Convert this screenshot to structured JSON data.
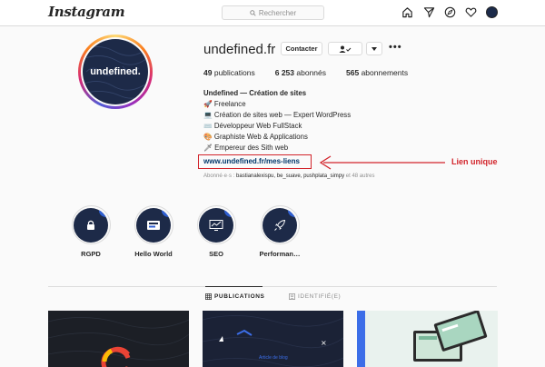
{
  "topbar": {
    "logo": "Instagram",
    "search_placeholder": "Rechercher",
    "icons": [
      "home-icon",
      "direct-icon",
      "explore-icon",
      "heart-icon",
      "avatar"
    ]
  },
  "profile": {
    "avatar_text": "undefined.",
    "username": "undefined.fr",
    "contact_label": "Contacter",
    "stats": [
      {
        "count": "49",
        "label": "publications"
      },
      {
        "count": "6 253",
        "label": "abonnés"
      },
      {
        "count": "565",
        "label": "abonnements"
      }
    ],
    "bio_name": "Undefined — Création de sites",
    "bio_lines": [
      "🚀 Freelance",
      "💻 Création de sites web — Expert WordPress",
      "⌨️ Développeur Web FullStack",
      "🎨 Graphiste Web & Applications",
      "🗡 Empereur des Sith web"
    ],
    "link": "www.undefined.fr/mes-liens",
    "followers_prefix": "Abonné·e·s : ",
    "followers_names": "bastianalexispu, be_suave, pushplata_simpy",
    "followers_suffix": " et 48 autres"
  },
  "annotation": {
    "text": "Lien unique",
    "color": "#d2232a"
  },
  "highlights": [
    {
      "label": "RGPD",
      "icon": "lock-icon"
    },
    {
      "label": "Hello World",
      "icon": "hello-world-icon"
    },
    {
      "label": "SEO",
      "icon": "chart-icon"
    },
    {
      "label": "Performan…",
      "icon": "rocket-icon"
    }
  ],
  "tabs": [
    {
      "label": "PUBLICATIONS",
      "active": true
    },
    {
      "label": "IDENTIFIÉ(E)",
      "active": false
    }
  ],
  "posts": [
    {
      "caption": ""
    },
    {
      "caption": "Article de blog"
    },
    {
      "caption": ""
    }
  ]
}
